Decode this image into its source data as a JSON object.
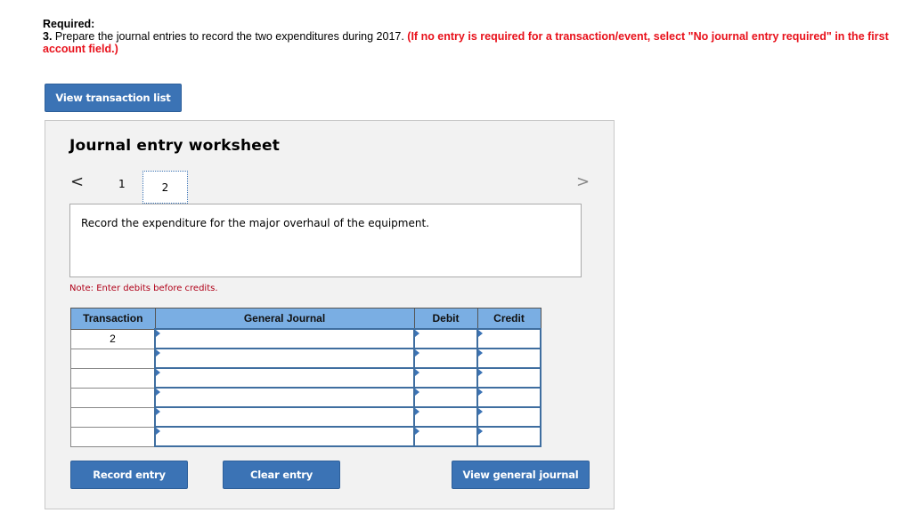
{
  "required": {
    "heading": "Required:",
    "number": "3.",
    "instruction": " Prepare the journal entries to record the two expenditures during 2017. ",
    "note_red": "(If no entry is required for a transaction/event, select \"No journal entry required\" in the first account field.)"
  },
  "buttons": {
    "view_transaction_list": "View transaction list",
    "record_entry": "Record entry",
    "clear_entry": "Clear entry",
    "view_general_journal": "View general journal"
  },
  "worksheet": {
    "title": "Journal entry worksheet",
    "nav_prev_icon": "‹",
    "nav_next_icon": "›",
    "tabs": [
      "1",
      "2"
    ],
    "active_tab": "2",
    "description": "Record the expenditure for the major overhaul of the equipment.",
    "note": "Note: Enter debits before credits."
  },
  "table": {
    "headers": [
      "Transaction",
      "General Journal",
      "Debit",
      "Credit"
    ],
    "rows": [
      {
        "transaction": "2",
        "account": "",
        "debit": "",
        "credit": ""
      },
      {
        "transaction": "",
        "account": "",
        "debit": "",
        "credit": ""
      },
      {
        "transaction": "",
        "account": "",
        "debit": "",
        "credit": ""
      },
      {
        "transaction": "",
        "account": "",
        "debit": "",
        "credit": ""
      },
      {
        "transaction": "",
        "account": "",
        "debit": "",
        "credit": ""
      },
      {
        "transaction": "",
        "account": "",
        "debit": "",
        "credit": ""
      }
    ]
  },
  "colors": {
    "button": "#3b73b5",
    "header": "#7aaee3",
    "red": "#e8101a",
    "note": "#b00018"
  }
}
